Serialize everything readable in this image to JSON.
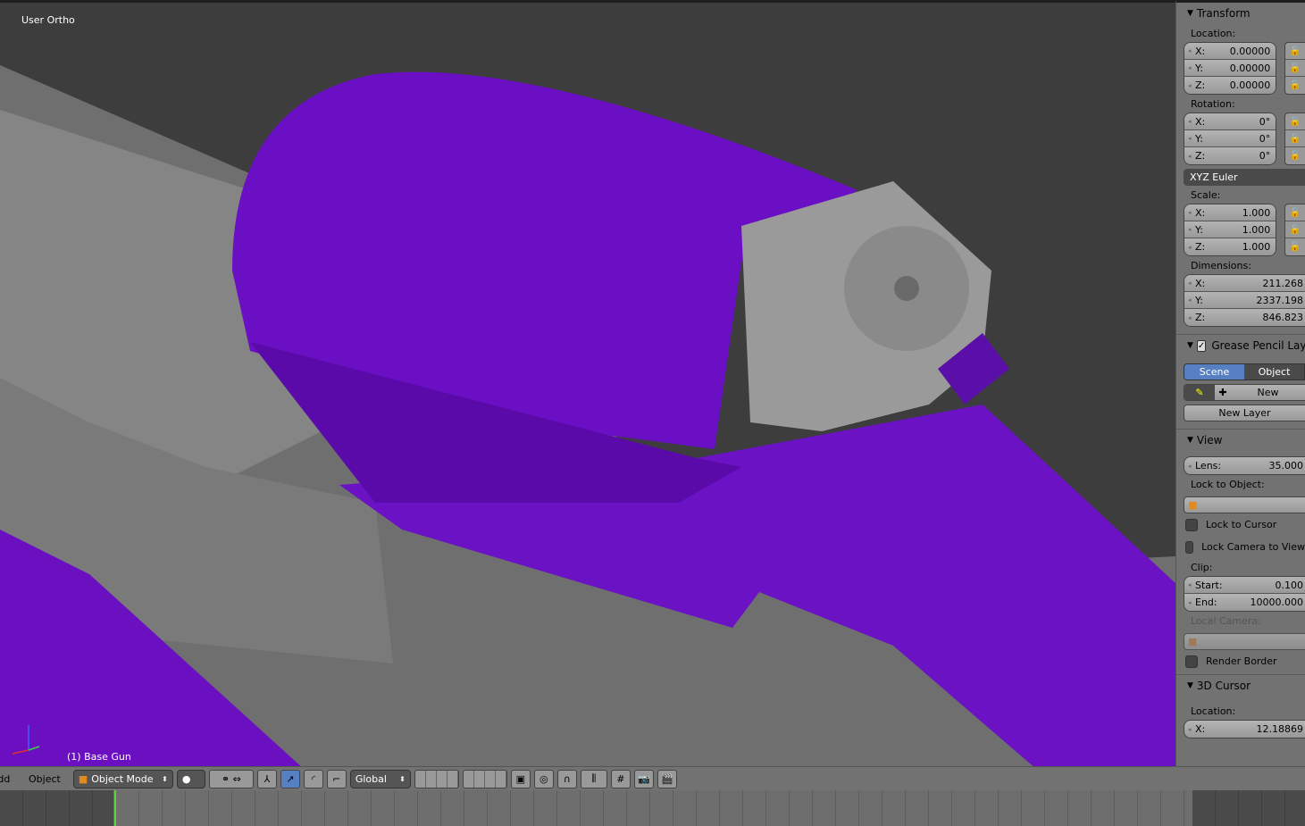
{
  "viewport": {
    "view_name": "User Ortho",
    "object_label": "(1) Base Gun",
    "accent": "#6a10c0"
  },
  "panel": {
    "transform": {
      "title": "Transform",
      "location_label": "Location:",
      "location": [
        {
          "k": "X:",
          "v": "0.00000"
        },
        {
          "k": "Y:",
          "v": "0.00000"
        },
        {
          "k": "Z:",
          "v": "0.00000"
        }
      ],
      "rotation_label": "Rotation:",
      "rotation": [
        {
          "k": "X:",
          "v": "0°"
        },
        {
          "k": "Y:",
          "v": "0°"
        },
        {
          "k": "Z:",
          "v": "0°"
        }
      ],
      "rotation_mode": "XYZ Euler",
      "scale_label": "Scale:",
      "scale": [
        {
          "k": "X:",
          "v": "1.000"
        },
        {
          "k": "Y:",
          "v": "1.000"
        },
        {
          "k": "Z:",
          "v": "1.000"
        }
      ],
      "dimensions_label": "Dimensions:",
      "dimensions": [
        {
          "k": "X:",
          "v": "211.268"
        },
        {
          "k": "Y:",
          "v": "2337.198"
        },
        {
          "k": "Z:",
          "v": "846.823"
        }
      ]
    },
    "grease": {
      "title": "Grease Pencil Lay",
      "tab_scene": "Scene",
      "tab_object": "Object",
      "new": "New",
      "new_layer": "New Layer"
    },
    "view": {
      "title": "View",
      "lens_k": "Lens:",
      "lens_v": "35.000",
      "lock_obj": "Lock to Object:",
      "lock_cursor": "Lock to Cursor",
      "lock_camera": "Lock Camera to View",
      "clip": "Clip:",
      "start_k": "Start:",
      "start_v": "0.100",
      "end_k": "End:",
      "end_v": "10000.000",
      "local_camera": "Local Camera:",
      "render_border": "Render Border"
    },
    "cursor": {
      "title": "3D Cursor",
      "location_label": "Location:",
      "x_k": "X:",
      "x_v": "12.18869"
    }
  },
  "header": {
    "add": "Add",
    "object": "Object",
    "mode": "Object Mode",
    "orientation": "Global"
  }
}
